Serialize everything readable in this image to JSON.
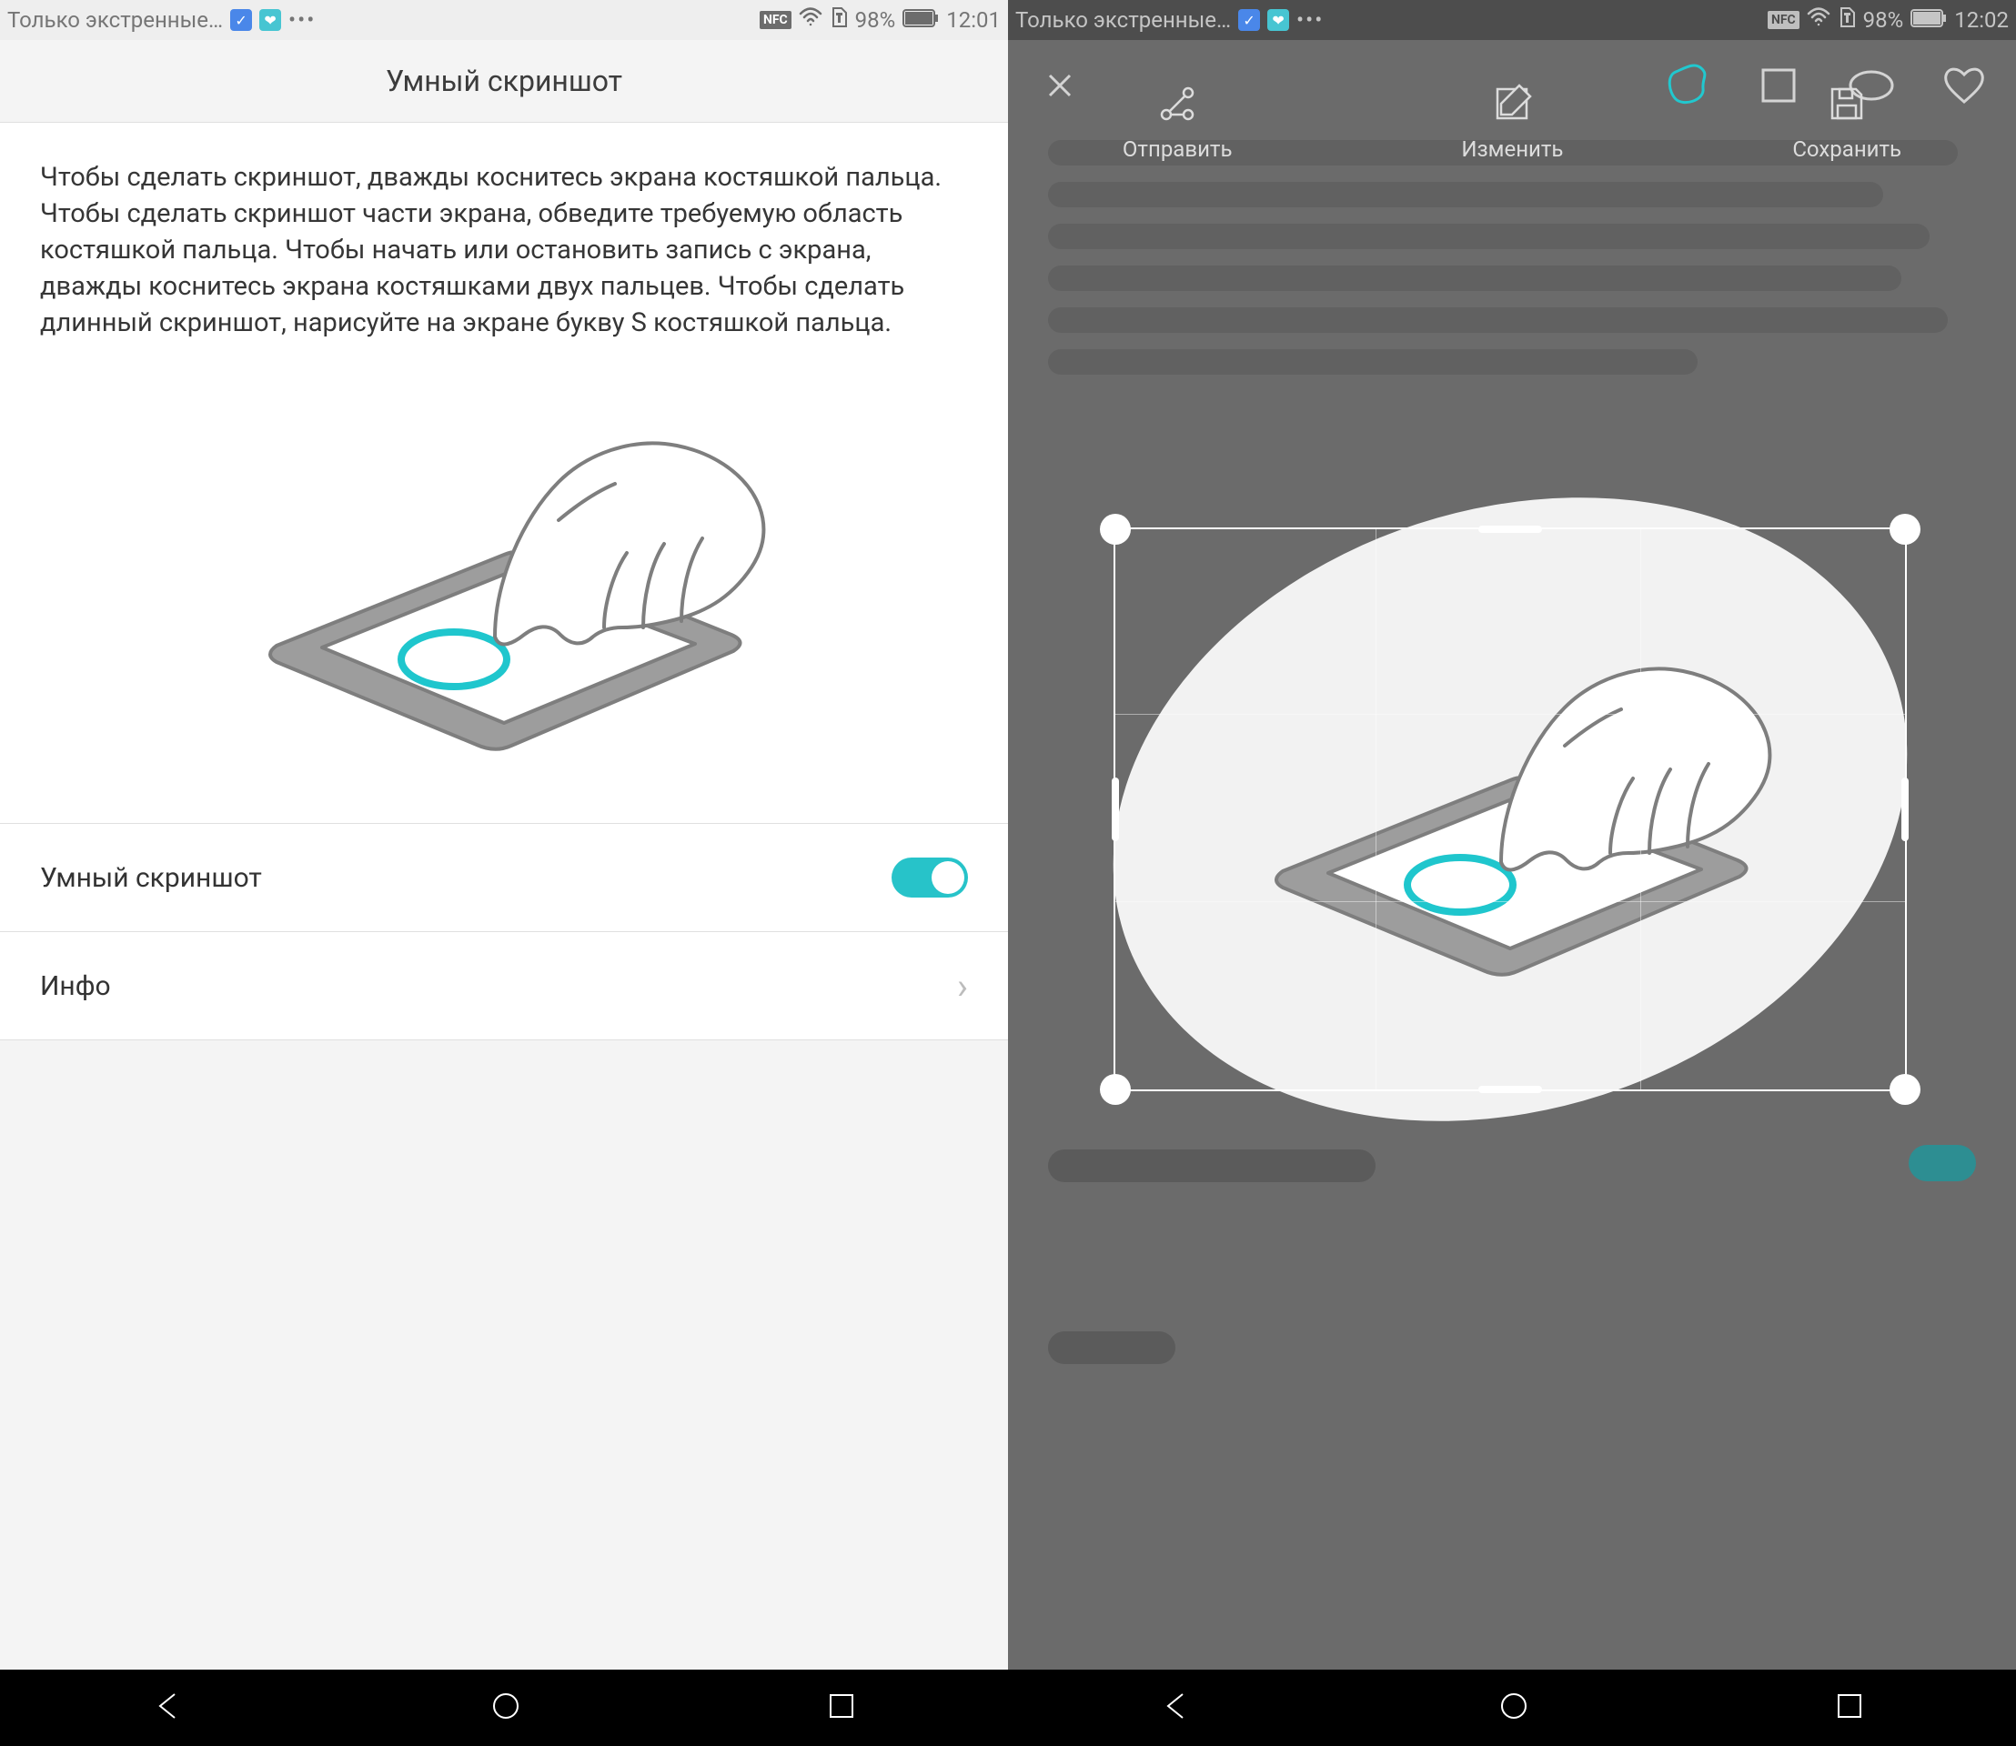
{
  "left": {
    "statusbar": {
      "carrier": "Только экстренные…",
      "nfc": "NFC",
      "battery_pct": "98%",
      "time": "12:01"
    },
    "title": "Умный скриншот",
    "description": "Чтобы сделать скриншот, дважды коснитесь экрана костяшкой пальца. Чтобы сделать скриншот части экрана, обведите требуемую область костяшкой пальца. Чтобы начать или остановить запись с экрана, дважды коснитесь экрана костяшками двух пальцев. Чтобы сделать длинный скриншот, нарисуйте на экране букву S костяшкой пальца.",
    "toggle_label": "Умный скриншот",
    "toggle_on": true,
    "info_label": "Инфо"
  },
  "right": {
    "statusbar": {
      "carrier": "Только экстренные…",
      "nfc": "NFC",
      "battery_pct": "98%",
      "time": "12:02"
    },
    "tools": {
      "close": "close",
      "free": "freeform-shape",
      "square": "square-shape",
      "oval": "oval-shape",
      "heart": "heart-shape",
      "active": "freeform-shape"
    },
    "actions": {
      "share": "Отправить",
      "edit": "Изменить",
      "save": "Сохранить"
    }
  },
  "colors": {
    "accent": "#21c8cf",
    "panel_bg": "#ffffff",
    "page_bg": "#f4f4f4",
    "right_bg": "#6b6b6b"
  }
}
